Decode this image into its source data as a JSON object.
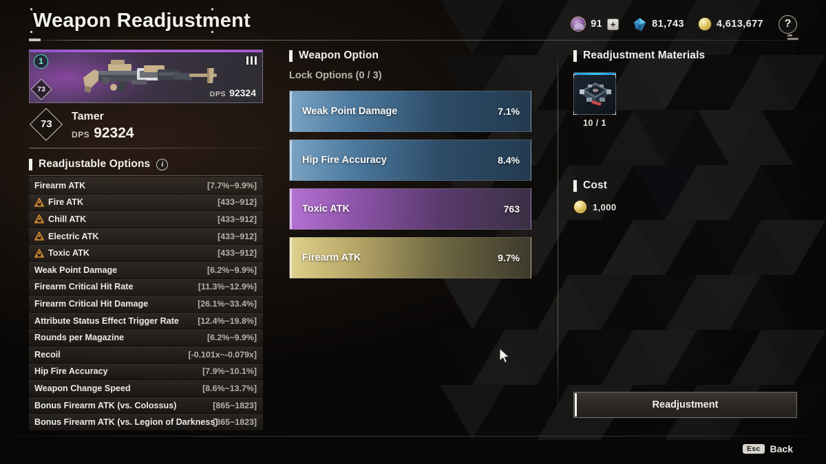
{
  "header": {
    "title": "Weapon Readjustment",
    "currencies": [
      {
        "icon": "caliber-icon",
        "value": "91",
        "has_plus": true,
        "plus_label": "+"
      },
      {
        "icon": "gem-icon",
        "value": "81,743",
        "has_plus": false,
        "plus_label": ""
      },
      {
        "icon": "gold-coin-icon",
        "value": "4,613,677",
        "has_plus": false,
        "plus_label": ""
      }
    ],
    "help_label": "?"
  },
  "weapon": {
    "card": {
      "tier_chip": "1",
      "level_badge": "73",
      "dps_key": "DPS",
      "dps_value": "92324",
      "ammo_bars": 3,
      "rarity_color": "#b055dd"
    },
    "level": "73",
    "name": "Tamer",
    "dps_key": "DPS",
    "dps_value": "92324"
  },
  "readjustable": {
    "section_title": "Readjustable Options",
    "info_icon_label": "i",
    "rows": [
      {
        "name": "Firearm ATK",
        "range": "[7.7%~9.9%]",
        "warn": false
      },
      {
        "name": "Fire ATK",
        "range": "[433~912]",
        "warn": true
      },
      {
        "name": "Chill ATK",
        "range": "[433~912]",
        "warn": true
      },
      {
        "name": "Electric ATK",
        "range": "[433~912]",
        "warn": true
      },
      {
        "name": "Toxic ATK",
        "range": "[433~912]",
        "warn": true
      },
      {
        "name": "Weak Point Damage",
        "range": "[6.2%~9.9%]",
        "warn": false
      },
      {
        "name": "Firearm Critical Hit Rate",
        "range": "[11.3%~12.9%]",
        "warn": false
      },
      {
        "name": "Firearm Critical Hit Damage",
        "range": "[26.1%~33.4%]",
        "warn": false
      },
      {
        "name": "Attribute Status Effect Trigger Rate",
        "range": "[12.4%~19.8%]",
        "warn": false
      },
      {
        "name": "Rounds per Magazine",
        "range": "[6.2%~9.9%]",
        "warn": false
      },
      {
        "name": "Recoil",
        "range": "[-0.101x~-0.079x]",
        "warn": false
      },
      {
        "name": "Hip Fire Accuracy",
        "range": "[7.9%~10.1%]",
        "warn": false
      },
      {
        "name": "Weapon Change Speed",
        "range": "[8.6%~13.7%]",
        "warn": false
      },
      {
        "name": "Bonus Firearm ATK (vs. Colossus)",
        "range": "[865~1823]",
        "warn": false
      },
      {
        "name": "Bonus Firearm ATK (vs. Legion of Darkness)",
        "range": "[865~1823]",
        "warn": false
      }
    ]
  },
  "weapon_option": {
    "section_title": "Weapon Option",
    "lock_label": "Lock Options (0 / 3)",
    "options": [
      {
        "name": "Weak Point Damage",
        "value": "7.1%",
        "color": "blue"
      },
      {
        "name": "Hip Fire Accuracy",
        "value": "8.4%",
        "color": "blue"
      },
      {
        "name": "Toxic ATK",
        "value": "763",
        "color": "purple"
      },
      {
        "name": "Firearm ATK",
        "value": "9.7%",
        "color": "gold"
      }
    ]
  },
  "materials": {
    "section_title": "Readjustment Materials",
    "items": [
      {
        "icon": "readjustment-module-icon",
        "count": "10 / 1"
      }
    ]
  },
  "cost": {
    "section_title": "Cost",
    "icon": "gold-coin-icon",
    "value": "1,000"
  },
  "actions": {
    "readjust_label": "Readjustment"
  },
  "footer": {
    "key": "Esc",
    "label": "Back"
  }
}
